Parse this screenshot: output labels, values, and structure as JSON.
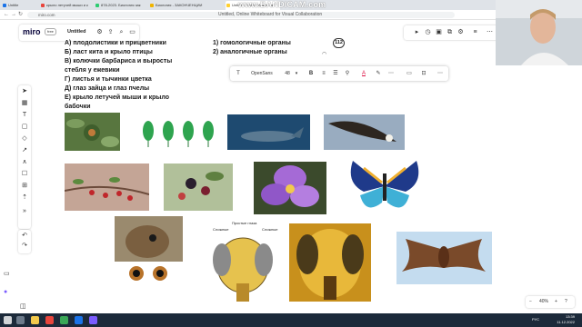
{
  "browser": {
    "tabs": [
      {
        "label": "Untitle",
        "color": "#1a73e8"
      },
      {
        "label": "крыло летучей мыши и к",
        "color": "#e8453c"
      },
      {
        "label": "878-2023. Биология зак",
        "color": "#2ecc71"
      },
      {
        "label": "Биология - ЗАКОНЧЕНЦИИ",
        "color": "#f0b400"
      },
      {
        "label": "Untitled, Online Whiteboa",
        "color": "#ffd02f"
      }
    ],
    "url": "miro.com",
    "window_title": "Untitled, Online Whiteboard for Visual Collaboration"
  },
  "watermark": "www.BANDICAM.com",
  "miro": {
    "logo": "miro",
    "plan_badge": "free",
    "board_title": "Untitled",
    "toolbar_icons": [
      "settings-icon",
      "share-icon",
      "search-icon",
      "comment-icon"
    ],
    "right_icons": [
      "play-icon",
      "timer-icon",
      "screen-icon",
      "share-screen-icon",
      "settings-icon",
      "filter-icon",
      "more-icon"
    ]
  },
  "board": {
    "left_items": [
      "А) плодолистики и прицветники",
      "Б)  ласт кита и крыло птицы",
      "В)  колючки барбариса и выросты",
      "стебля у ежевики",
      "Г)  листья и тычинки цветка",
      "Д)  глаз зайца и глаз пчелы",
      "Е)  крыло летучей мыши и крыло",
      "бабочки"
    ],
    "right_items": [
      "1)  гомологичные органы",
      "2)  аналогичные органы"
    ],
    "user_count": "112",
    "diagram_labels": [
      "Простые глаза",
      "Сложные",
      "Сложные"
    ]
  },
  "context_toolbar": {
    "font": "OpenSans",
    "font_size": "48"
  },
  "zoom": {
    "value": "40%"
  },
  "taskbar": {
    "time": "13:39",
    "date": "11.12.2022",
    "lang": "РУС"
  },
  "colors": {
    "browser_bg": "#dfe3e8",
    "taskbar": "#1c2a3a",
    "miro_yellow": "#ffd02f"
  }
}
